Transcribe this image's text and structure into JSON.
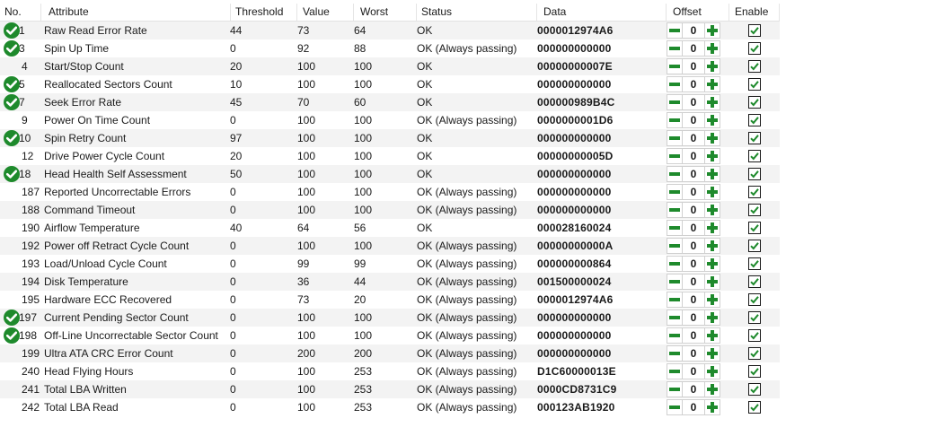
{
  "columns": {
    "no": "No.",
    "attribute": "Attribute",
    "threshold": "Threshold",
    "value": "Value",
    "worst": "Worst",
    "status": "Status",
    "data": "Data",
    "offset": "Offset",
    "enable": "Enable"
  },
  "colors": {
    "ok_green": "#1e8a2c",
    "alt_row": "#f3f3f3"
  },
  "rows": [
    {
      "no": "1",
      "attribute": "Raw Read Error Rate",
      "threshold": "44",
      "value": "73",
      "worst": "64",
      "status": "OK",
      "data": "0000012974A6",
      "offset": "0",
      "ok_icon": true,
      "enabled": true
    },
    {
      "no": "3",
      "attribute": "Spin Up Time",
      "threshold": "0",
      "value": "92",
      "worst": "88",
      "status": "OK (Always passing)",
      "data": "000000000000",
      "offset": "0",
      "ok_icon": true,
      "enabled": true
    },
    {
      "no": "4",
      "attribute": "Start/Stop Count",
      "threshold": "20",
      "value": "100",
      "worst": "100",
      "status": "OK",
      "data": "00000000007E",
      "offset": "0",
      "ok_icon": false,
      "enabled": true
    },
    {
      "no": "5",
      "attribute": "Reallocated Sectors Count",
      "threshold": "10",
      "value": "100",
      "worst": "100",
      "status": "OK",
      "data": "000000000000",
      "offset": "0",
      "ok_icon": true,
      "enabled": true
    },
    {
      "no": "7",
      "attribute": "Seek Error Rate",
      "threshold": "45",
      "value": "70",
      "worst": "60",
      "status": "OK",
      "data": "000000989B4C",
      "offset": "0",
      "ok_icon": true,
      "enabled": true
    },
    {
      "no": "9",
      "attribute": "Power On Time Count",
      "threshold": "0",
      "value": "100",
      "worst": "100",
      "status": "OK (Always passing)",
      "data": "0000000001D6",
      "offset": "0",
      "ok_icon": false,
      "enabled": true
    },
    {
      "no": "10",
      "attribute": "Spin Retry Count",
      "threshold": "97",
      "value": "100",
      "worst": "100",
      "status": "OK",
      "data": "000000000000",
      "offset": "0",
      "ok_icon": true,
      "enabled": true
    },
    {
      "no": "12",
      "attribute": "Drive Power Cycle Count",
      "threshold": "20",
      "value": "100",
      "worst": "100",
      "status": "OK",
      "data": "00000000005D",
      "offset": "0",
      "ok_icon": false,
      "enabled": true
    },
    {
      "no": "18",
      "attribute": "Head Health Self Assessment",
      "threshold": "50",
      "value": "100",
      "worst": "100",
      "status": "OK",
      "data": "000000000000",
      "offset": "0",
      "ok_icon": true,
      "enabled": true
    },
    {
      "no": "187",
      "attribute": "Reported Uncorrectable Errors",
      "threshold": "0",
      "value": "100",
      "worst": "100",
      "status": "OK (Always passing)",
      "data": "000000000000",
      "offset": "0",
      "ok_icon": false,
      "enabled": true
    },
    {
      "no": "188",
      "attribute": "Command Timeout",
      "threshold": "0",
      "value": "100",
      "worst": "100",
      "status": "OK (Always passing)",
      "data": "000000000000",
      "offset": "0",
      "ok_icon": false,
      "enabled": true
    },
    {
      "no": "190",
      "attribute": "Airflow Temperature",
      "threshold": "40",
      "value": "64",
      "worst": "56",
      "status": "OK",
      "data": "000028160024",
      "offset": "0",
      "ok_icon": false,
      "enabled": true
    },
    {
      "no": "192",
      "attribute": "Power off Retract Cycle Count",
      "threshold": "0",
      "value": "100",
      "worst": "100",
      "status": "OK (Always passing)",
      "data": "00000000000A",
      "offset": "0",
      "ok_icon": false,
      "enabled": true
    },
    {
      "no": "193",
      "attribute": "Load/Unload Cycle Count",
      "threshold": "0",
      "value": "99",
      "worst": "99",
      "status": "OK (Always passing)",
      "data": "000000000864",
      "offset": "0",
      "ok_icon": false,
      "enabled": true
    },
    {
      "no": "194",
      "attribute": "Disk Temperature",
      "threshold": "0",
      "value": "36",
      "worst": "44",
      "status": "OK (Always passing)",
      "data": "001500000024",
      "offset": "0",
      "ok_icon": false,
      "enabled": true
    },
    {
      "no": "195",
      "attribute": "Hardware ECC Recovered",
      "threshold": "0",
      "value": "73",
      "worst": "20",
      "status": "OK (Always passing)",
      "data": "0000012974A6",
      "offset": "0",
      "ok_icon": false,
      "enabled": true
    },
    {
      "no": "197",
      "attribute": "Current Pending Sector Count",
      "threshold": "0",
      "value": "100",
      "worst": "100",
      "status": "OK (Always passing)",
      "data": "000000000000",
      "offset": "0",
      "ok_icon": true,
      "enabled": true
    },
    {
      "no": "198",
      "attribute": "Off-Line Uncorrectable Sector Count",
      "threshold": "0",
      "value": "100",
      "worst": "100",
      "status": "OK (Always passing)",
      "data": "000000000000",
      "offset": "0",
      "ok_icon": true,
      "enabled": true
    },
    {
      "no": "199",
      "attribute": "Ultra ATA CRC Error Count",
      "threshold": "0",
      "value": "200",
      "worst": "200",
      "status": "OK (Always passing)",
      "data": "000000000000",
      "offset": "0",
      "ok_icon": false,
      "enabled": true
    },
    {
      "no": "240",
      "attribute": "Head Flying Hours",
      "threshold": "0",
      "value": "100",
      "worst": "253",
      "status": "OK (Always passing)",
      "data": "D1C60000013E",
      "offset": "0",
      "ok_icon": false,
      "enabled": true
    },
    {
      "no": "241",
      "attribute": "Total LBA Written",
      "threshold": "0",
      "value": "100",
      "worst": "253",
      "status": "OK (Always passing)",
      "data": "0000CD8731C9",
      "offset": "0",
      "ok_icon": false,
      "enabled": true
    },
    {
      "no": "242",
      "attribute": "Total LBA Read",
      "threshold": "0",
      "value": "100",
      "worst": "253",
      "status": "OK (Always passing)",
      "data": "000123AB1920",
      "offset": "0",
      "ok_icon": false,
      "enabled": true
    }
  ]
}
